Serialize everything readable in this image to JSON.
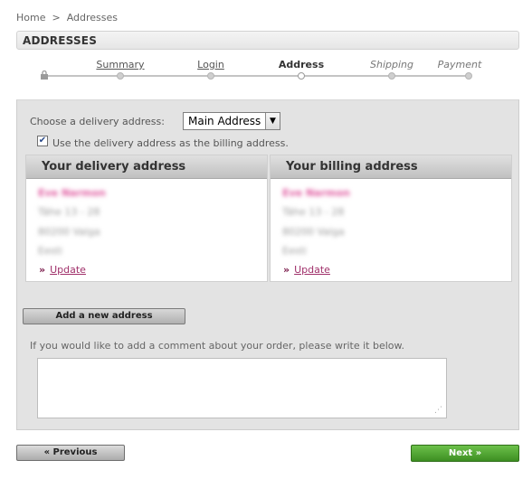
{
  "breadcrumb": {
    "home": "Home",
    "separator": ">",
    "current": "Addresses"
  },
  "section": {
    "title": "ADDRESSES"
  },
  "steps": [
    {
      "label": "Summary",
      "state": "done"
    },
    {
      "label": "Login",
      "state": "done"
    },
    {
      "label": "Address",
      "state": "current"
    },
    {
      "label": "Shipping",
      "state": "future"
    },
    {
      "label": "Payment",
      "state": "future"
    }
  ],
  "delivery_choice": {
    "label": "Choose a delivery address:",
    "selected": "Main Address"
  },
  "billing_same": {
    "checked": true,
    "label": "Use the delivery address as the billing address."
  },
  "delivery_address": {
    "heading": "Your delivery address",
    "lines": [
      "Eve Narmon",
      "Tähe 13 - 28",
      "80200 Valga",
      "Eesti"
    ],
    "update_label": "Update"
  },
  "billing_address": {
    "heading": "Your billing address",
    "lines": [
      "Eve Narmon",
      "Tähe 13 - 28",
      "80200 Valga",
      "Eesti"
    ],
    "update_label": "Update"
  },
  "add_address_label": "Add a new address",
  "comment": {
    "label": "If you would like to add a comment about your order, please write it below.",
    "value": ""
  },
  "nav": {
    "prev_label": "« Previous",
    "next_label": "Next »"
  },
  "colors": {
    "accent_link": "#a0306a",
    "next_button": "#4fa431",
    "panel": "#e3e3e3"
  }
}
